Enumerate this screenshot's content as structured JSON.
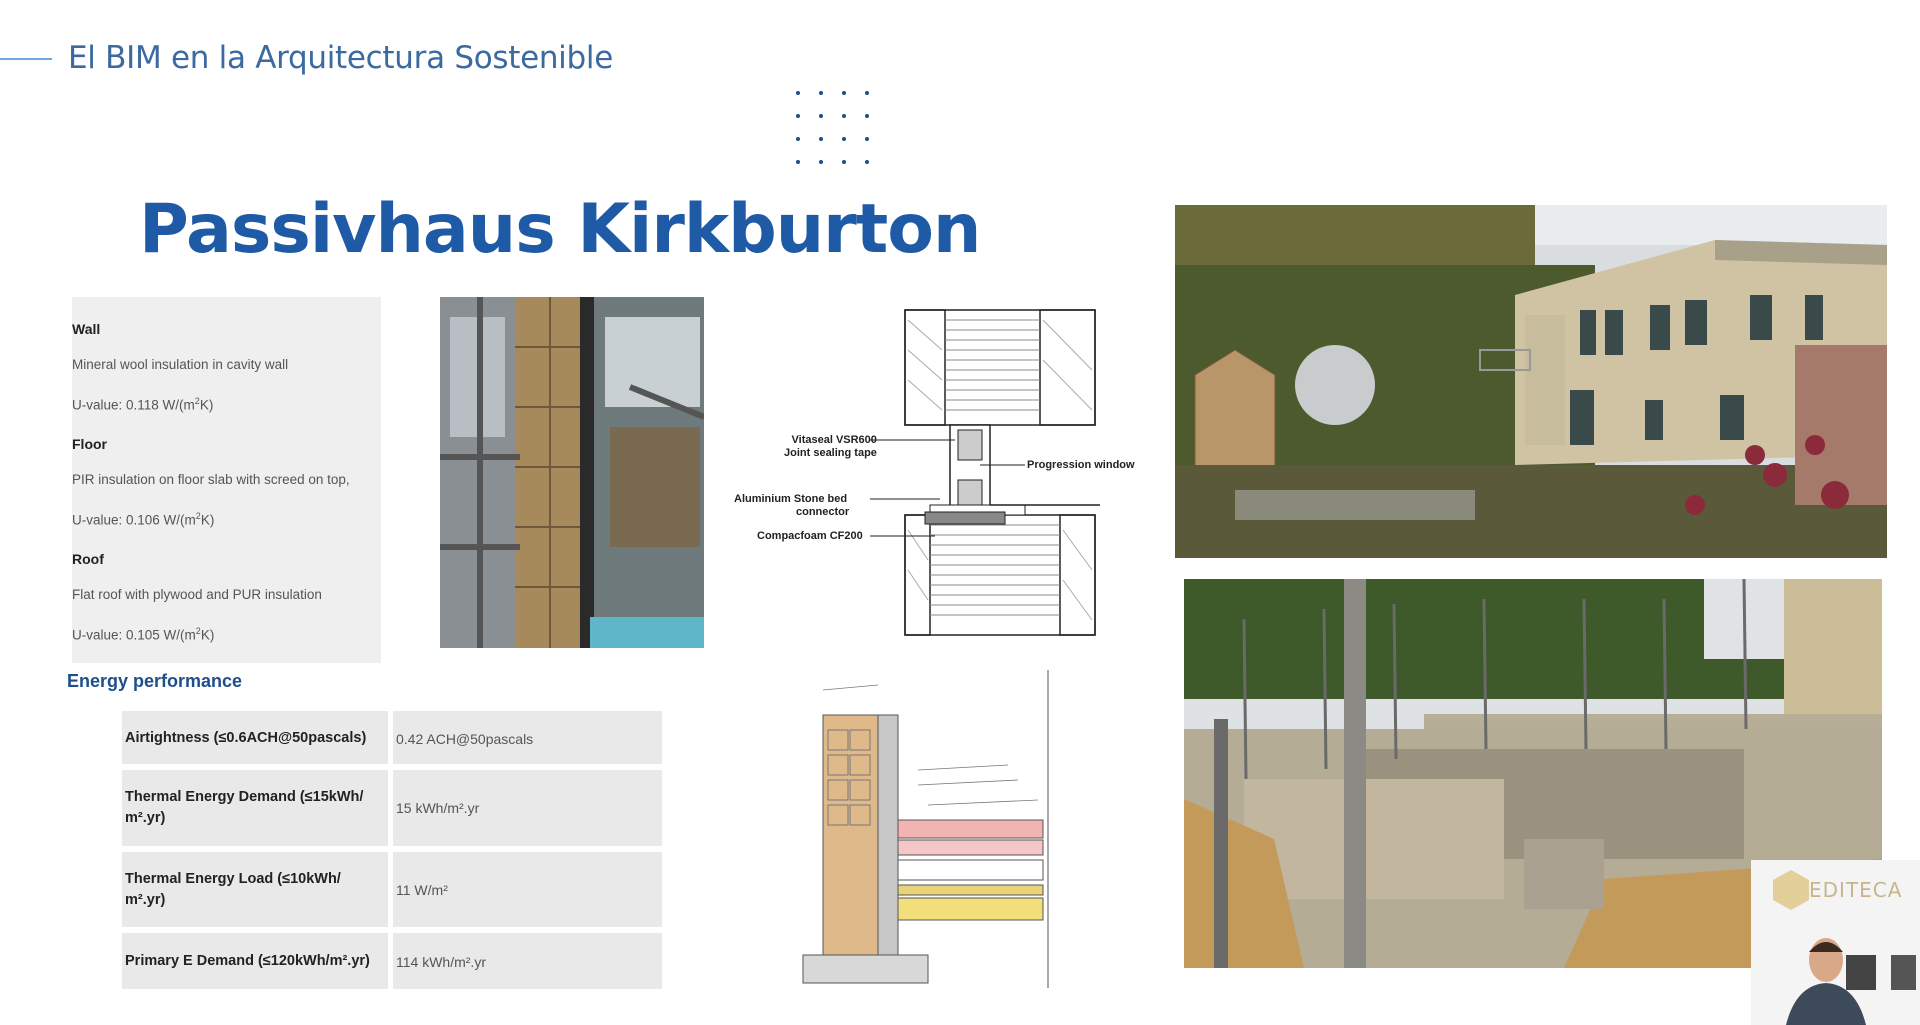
{
  "header": {
    "course_title": "El BIM en la Arquitectura Sostenible"
  },
  "slide": {
    "title": "Passivhaus Kirkburton",
    "specs": {
      "wall_heading": "Wall",
      "wall_desc": "Mineral wool insulation in cavity wall",
      "wall_uvalue_prefix": "U-value: 0.118 W/(m",
      "wall_uvalue_sup": "2",
      "wall_uvalue_suffix": "K)",
      "floor_heading": "Floor",
      "floor_desc": "PIR insulation on floor slab with screed on top,",
      "floor_uvalue_prefix": "U-value: 0.106 W/(m",
      "floor_uvalue_sup": "2",
      "floor_uvalue_suffix": "K)",
      "roof_heading": "Roof",
      "roof_desc": "Flat roof with plywood and PUR insulation",
      "roof_uvalue_prefix": "U-value: 0.105 W/(m",
      "roof_uvalue_sup": "2",
      "roof_uvalue_suffix": "K)"
    },
    "energy": {
      "title": "Energy performance",
      "rows": [
        {
          "label_line1": "Airtightness (≤0.6ACH@50pascals)",
          "label_line2": "",
          "value": "0.42 ACH@50pascals"
        },
        {
          "label_line1": "Thermal Energy Demand (≤15kWh/",
          "label_line2": "m².yr)",
          "value": "15 kWh/m².yr"
        },
        {
          "label_line1": "Thermal Energy Load (≤10kWh/",
          "label_line2": "m².yr)",
          "value": "11 W/m²"
        },
        {
          "label_line1": "Primary E Demand (≤120kWh/m².yr)",
          "label_line2": "",
          "value": "114 kWh/m².yr"
        }
      ]
    },
    "diagram": {
      "label_vitaseal_1": "Vitaseal VSR600",
      "label_vitaseal_2": "Joint sealing tape",
      "label_progression": "Progression window",
      "label_aluminium_1": "Aluminium Stone bed",
      "label_aluminium_2": "connector",
      "label_compacfoam": "Compacfoam CF200"
    },
    "webcam": {
      "logo": "EDITECA"
    }
  }
}
